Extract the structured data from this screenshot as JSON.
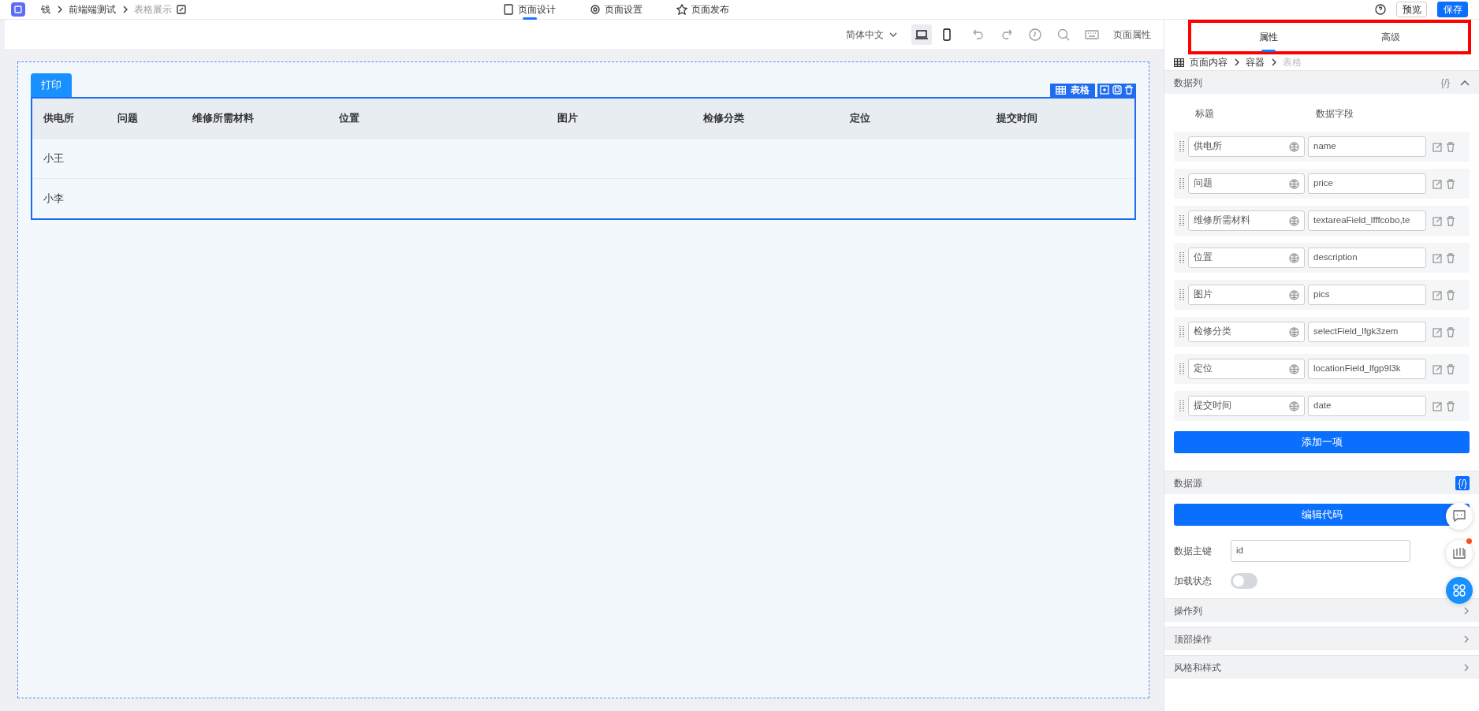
{
  "header": {
    "breadcrumb": [
      {
        "label": "钱",
        "current": false
      },
      {
        "label": "前端端测试",
        "current": false
      },
      {
        "label": "表格展示",
        "current": true
      }
    ],
    "tabs": [
      {
        "label": "页面设计",
        "kind": "design",
        "selected": true
      },
      {
        "label": "页面设置",
        "kind": "settings",
        "selected": false
      },
      {
        "label": "页面发布",
        "kind": "publish",
        "selected": false
      }
    ],
    "buttons": [
      {
        "label": "预览",
        "kind": "secondary"
      },
      {
        "label": "保存",
        "kind": "primary"
      }
    ]
  },
  "toolbar": {
    "language": "简体中文",
    "devices": [
      {
        "kind": "desktop",
        "selected": true
      },
      {
        "kind": "mobile",
        "selected": false
      }
    ],
    "page_properties": "页面属性"
  },
  "canvas": {
    "print_button": "打印",
    "component_tag": "表格",
    "table": {
      "columns": [
        "供电所",
        "问题",
        "维修所需材料",
        "位置",
        "图片",
        "检修分类",
        "定位",
        "提交时间"
      ],
      "rows": [
        {
          "cells": [
            "小王"
          ]
        },
        {
          "cells": [
            "小李"
          ]
        }
      ]
    }
  },
  "panel": {
    "tabs_highlighted": true,
    "tabs": [
      {
        "label": "属性",
        "selected": true
      },
      {
        "label": "高级",
        "selected": false
      }
    ],
    "breadcrumb": [
      {
        "label": "页面内容",
        "current": false
      },
      {
        "label": "容器",
        "current": false
      },
      {
        "label": "表格",
        "current": true
      }
    ],
    "data_columns": {
      "title": "数据列",
      "code_label": "{/}",
      "expanded": true,
      "headers": [
        "标题",
        "数据字段"
      ],
      "items": [
        {
          "title": "供电所",
          "field": "name"
        },
        {
          "title": "问题",
          "field": "price"
        },
        {
          "title": "维修所需材料",
          "field": "textareaField_lfffcobo,te"
        },
        {
          "title": "位置",
          "field": "description"
        },
        {
          "title": "图片",
          "field": "pics"
        },
        {
          "title": "检修分类",
          "field": "selectField_lfgk3zem"
        },
        {
          "title": "定位",
          "field": "locationField_lfgp9l3k"
        },
        {
          "title": "提交时间",
          "field": "date"
        }
      ],
      "add_button": "添加一项"
    },
    "data_source": {
      "title": "数据源",
      "code_label": "{/}",
      "code_active": true,
      "edit_button": "编辑代码",
      "primary_key": {
        "label": "数据主键",
        "value": "id"
      },
      "loading": {
        "label": "加载状态",
        "on": false
      }
    },
    "sections": [
      {
        "title": "操作列"
      },
      {
        "title": "顶部操作"
      },
      {
        "title": "风格和样式"
      }
    ]
  }
}
